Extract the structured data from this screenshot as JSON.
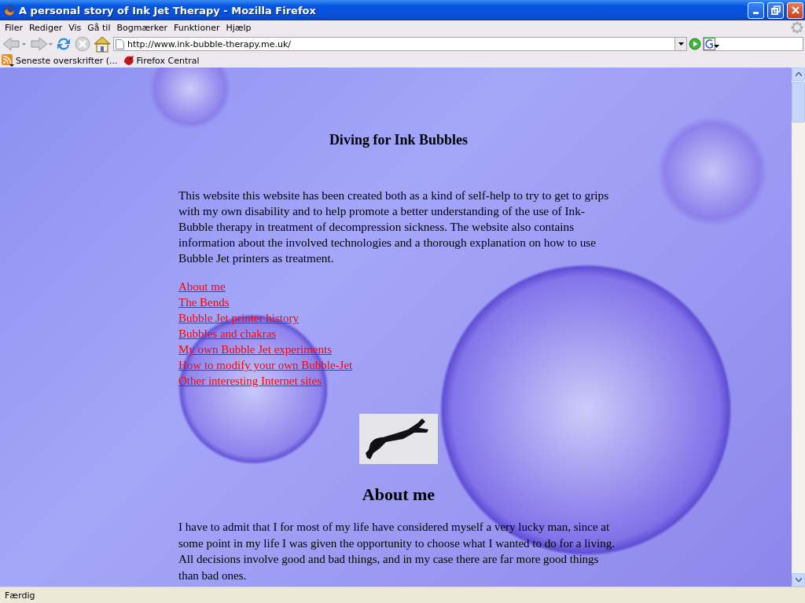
{
  "window": {
    "title": "A personal story of Ink Jet Therapy - Mozilla Firefox"
  },
  "menu": [
    "Filer",
    "Rediger",
    "Vis",
    "Gå til",
    "Bogmærker",
    "Funktioner",
    "Hjælp"
  ],
  "address_bar": {
    "value": "http://www.ink-bubble-therapy.me.uk/"
  },
  "bookmarks": [
    {
      "kind": "feed",
      "label": "Seneste overskrifter (..."
    },
    {
      "kind": "page",
      "label": "Firefox Central"
    }
  ],
  "page": {
    "title": "Diving for Ink Bubbles",
    "intro": "This website this website has been created both as a kind of self-help to try to get to grips with my own disability and to help promote a better understanding of the use of Ink-Bubble therapy in treatment of decompression sickness. The website also contains information about the involved technologies and a thorough explanation on how to use Bubble Jet printers as treatment.",
    "links": [
      "About me",
      "The Bends ",
      "Bubble Jet printer history",
      "Bubbles and chakras",
      "My own Bubble Jet experiments",
      "How to modify your own Bubble-Jet",
      "Other interesting Internet sites"
    ],
    "section_heading": "About me",
    "section_text": "I have to admit that I for most of my life have considered myself a very lucky man, since at some point in my life I was given the opportunity to choose what I wanted to do for a living. All decisions involve good and bad things, and in my case there are far more good things than bad ones."
  },
  "status_bar": "Færdig"
}
